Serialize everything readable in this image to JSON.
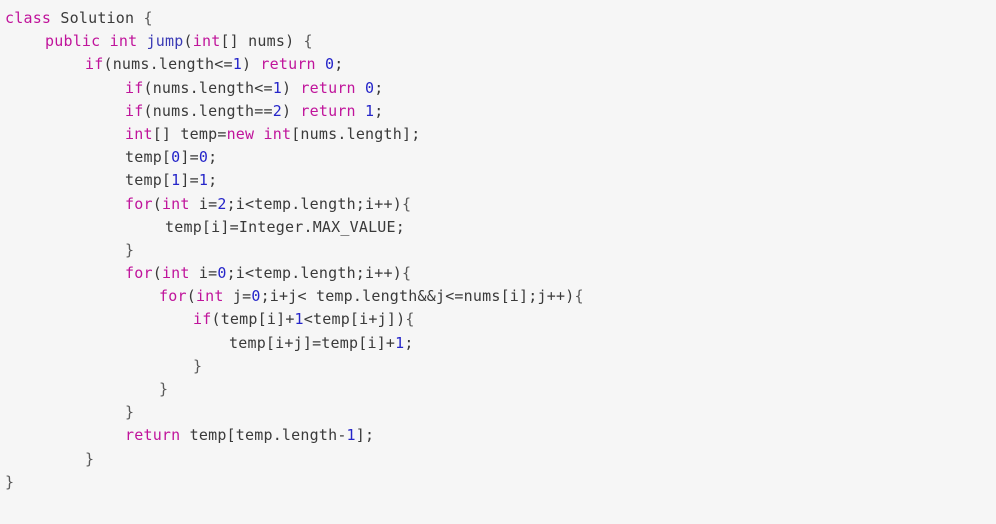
{
  "editor": {
    "language": "java",
    "background_color": "#f6f6f6",
    "keyword_color": "#c0149b",
    "function_color": "#3a3ab5",
    "number_color": "#2525c9",
    "text_color": "#3a3a3a"
  },
  "code": {
    "lines": [
      {
        "indent": 0,
        "tokens": [
          {
            "t": "class",
            "c": "kw"
          },
          {
            "t": " ",
            "c": "plain"
          },
          {
            "t": "Solution",
            "c": "plain"
          },
          {
            "t": " ",
            "c": "plain"
          },
          {
            "t": "{",
            "c": "brace"
          }
        ]
      },
      {
        "indent": 1,
        "tokens": [
          {
            "t": "public",
            "c": "kw"
          },
          {
            "t": " ",
            "c": "plain"
          },
          {
            "t": "int",
            "c": "kw"
          },
          {
            "t": " ",
            "c": "plain"
          },
          {
            "t": "jump",
            "c": "fn"
          },
          {
            "t": "(",
            "c": "punct"
          },
          {
            "t": "int",
            "c": "kw"
          },
          {
            "t": "[] ",
            "c": "punct"
          },
          {
            "t": "nums",
            "c": "plain"
          },
          {
            "t": ")",
            "c": "punct"
          },
          {
            "t": " ",
            "c": "plain"
          },
          {
            "t": "{",
            "c": "brace"
          }
        ]
      },
      {
        "indent": 2,
        "tokens": [
          {
            "t": "if",
            "c": "kw"
          },
          {
            "t": "(nums.length<=",
            "c": "plain"
          },
          {
            "t": "1",
            "c": "num"
          },
          {
            "t": ")",
            "c": "plain"
          },
          {
            "t": " ",
            "c": "plain"
          },
          {
            "t": "return",
            "c": "kw"
          },
          {
            "t": " ",
            "c": "plain"
          },
          {
            "t": "0",
            "c": "num"
          },
          {
            "t": ";",
            "c": "plain"
          }
        ]
      },
      {
        "indent": 3,
        "tokens": [
          {
            "t": "if",
            "c": "kw"
          },
          {
            "t": "(nums.length<=",
            "c": "plain"
          },
          {
            "t": "1",
            "c": "num"
          },
          {
            "t": ")",
            "c": "plain"
          },
          {
            "t": " ",
            "c": "plain"
          },
          {
            "t": "return",
            "c": "kw"
          },
          {
            "t": " ",
            "c": "plain"
          },
          {
            "t": "0",
            "c": "num"
          },
          {
            "t": ";",
            "c": "plain"
          }
        ]
      },
      {
        "indent": 3,
        "tokens": [
          {
            "t": "if",
            "c": "kw"
          },
          {
            "t": "(nums.length==",
            "c": "plain"
          },
          {
            "t": "2",
            "c": "num"
          },
          {
            "t": ")",
            "c": "plain"
          },
          {
            "t": " ",
            "c": "plain"
          },
          {
            "t": "return",
            "c": "kw"
          },
          {
            "t": " ",
            "c": "plain"
          },
          {
            "t": "1",
            "c": "num"
          },
          {
            "t": ";",
            "c": "plain"
          }
        ]
      },
      {
        "indent": 3,
        "tokens": [
          {
            "t": "int",
            "c": "kw"
          },
          {
            "t": "[] ",
            "c": "plain"
          },
          {
            "t": "temp=",
            "c": "plain"
          },
          {
            "t": "new",
            "c": "kw"
          },
          {
            "t": " ",
            "c": "plain"
          },
          {
            "t": "int",
            "c": "kw"
          },
          {
            "t": "[nums.length];",
            "c": "plain"
          }
        ]
      },
      {
        "indent": 3,
        "tokens": [
          {
            "t": "temp[",
            "c": "plain"
          },
          {
            "t": "0",
            "c": "num"
          },
          {
            "t": "]=",
            "c": "plain"
          },
          {
            "t": "0",
            "c": "num"
          },
          {
            "t": ";",
            "c": "plain"
          }
        ]
      },
      {
        "indent": 3,
        "tokens": [
          {
            "t": "temp[",
            "c": "plain"
          },
          {
            "t": "1",
            "c": "num"
          },
          {
            "t": "]=",
            "c": "plain"
          },
          {
            "t": "1",
            "c": "num"
          },
          {
            "t": ";",
            "c": "plain"
          }
        ]
      },
      {
        "indent": 3,
        "tokens": [
          {
            "t": "for",
            "c": "kw"
          },
          {
            "t": "(",
            "c": "plain"
          },
          {
            "t": "int",
            "c": "kw"
          },
          {
            "t": " i=",
            "c": "plain"
          },
          {
            "t": "2",
            "c": "num"
          },
          {
            "t": ";i<temp.length;i++)",
            "c": "plain"
          },
          {
            "t": "{",
            "c": "brace"
          }
        ]
      },
      {
        "indent": 4,
        "tokens": [
          {
            "t": "temp[i]=Integer.MAX_VALUE;",
            "c": "plain"
          }
        ]
      },
      {
        "indent": 3,
        "tokens": [
          {
            "t": "}",
            "c": "brace"
          }
        ]
      },
      {
        "indent": 3,
        "tokens": [
          {
            "t": "for",
            "c": "kw"
          },
          {
            "t": "(",
            "c": "plain"
          },
          {
            "t": "int",
            "c": "kw"
          },
          {
            "t": " i=",
            "c": "plain"
          },
          {
            "t": "0",
            "c": "num"
          },
          {
            "t": ";i<temp.length;i++)",
            "c": "plain"
          },
          {
            "t": "{",
            "c": "brace"
          }
        ]
      },
      {
        "indent": 3.85,
        "tokens": [
          {
            "t": "for",
            "c": "kw"
          },
          {
            "t": "(",
            "c": "plain"
          },
          {
            "t": "int",
            "c": "kw"
          },
          {
            "t": " j=",
            "c": "plain"
          },
          {
            "t": "0",
            "c": "num"
          },
          {
            "t": ";i+j< temp.length&&j<=nums[i];j++)",
            "c": "plain"
          },
          {
            "t": "{",
            "c": "brace"
          }
        ]
      },
      {
        "indent": 4.7,
        "tokens": [
          {
            "t": "if",
            "c": "kw"
          },
          {
            "t": "(temp[i]+",
            "c": "plain"
          },
          {
            "t": "1",
            "c": "num"
          },
          {
            "t": "<temp[i+j])",
            "c": "plain"
          },
          {
            "t": "{",
            "c": "brace"
          }
        ]
      },
      {
        "indent": 5.6,
        "tokens": [
          {
            "t": "temp[i+j]=temp[i]+",
            "c": "plain"
          },
          {
            "t": "1",
            "c": "num"
          },
          {
            "t": ";",
            "c": "plain"
          }
        ]
      },
      {
        "indent": 4.7,
        "tokens": [
          {
            "t": "}",
            "c": "brace"
          }
        ]
      },
      {
        "indent": 3.85,
        "tokens": [
          {
            "t": "}",
            "c": "brace"
          }
        ]
      },
      {
        "indent": 3,
        "tokens": [
          {
            "t": "}",
            "c": "brace"
          }
        ]
      },
      {
        "indent": 3,
        "tokens": [
          {
            "t": "return",
            "c": "kw"
          },
          {
            "t": " temp[temp.length-",
            "c": "plain"
          },
          {
            "t": "1",
            "c": "num"
          },
          {
            "t": "];",
            "c": "plain"
          }
        ]
      },
      {
        "indent": 2,
        "tokens": [
          {
            "t": "}",
            "c": "brace"
          }
        ]
      },
      {
        "indent": 0,
        "tokens": [
          {
            "t": "}",
            "c": "brace"
          }
        ]
      }
    ]
  }
}
